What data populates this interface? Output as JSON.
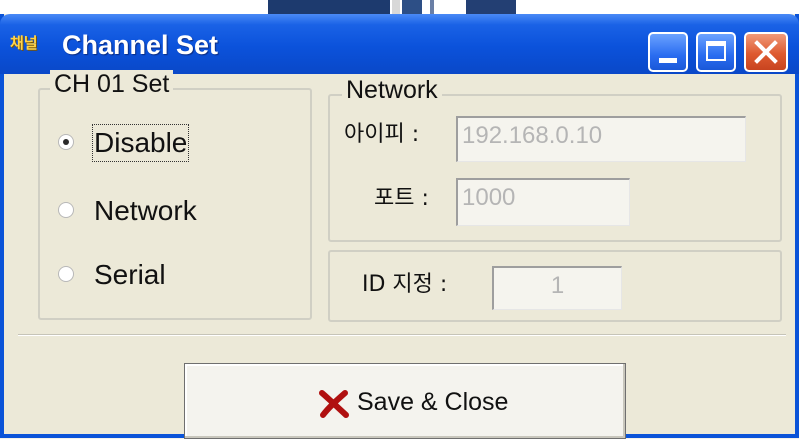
{
  "window": {
    "app_icon_text": "채널",
    "title": "Channel Set",
    "controls": {
      "minimize_icon": "minimize-icon",
      "maximize_icon": "maximize-icon",
      "close_icon": "close-icon"
    }
  },
  "channel_group": {
    "legend": "CH 01 Set",
    "options": [
      {
        "label": "Disable",
        "selected": true
      },
      {
        "label": "Network",
        "selected": false
      },
      {
        "label": "Serial",
        "selected": false
      }
    ]
  },
  "network_group": {
    "legend": "Network",
    "ip_label": "아이피 :",
    "ip_value": "192.168.0.10",
    "port_label": "포트 :",
    "port_value": "1000"
  },
  "id_group": {
    "label": "ID 지정 :",
    "value": "1"
  },
  "actions": {
    "save_close_label": "Save & Close",
    "save_close_icon": "x-mark-icon"
  },
  "colors": {
    "titlebar": "#0b52db",
    "close_button": "#de5a30",
    "dialog_bg": "#ece9d8",
    "disabled_text": "#b5b5b5",
    "x_mark": "#b01010"
  }
}
